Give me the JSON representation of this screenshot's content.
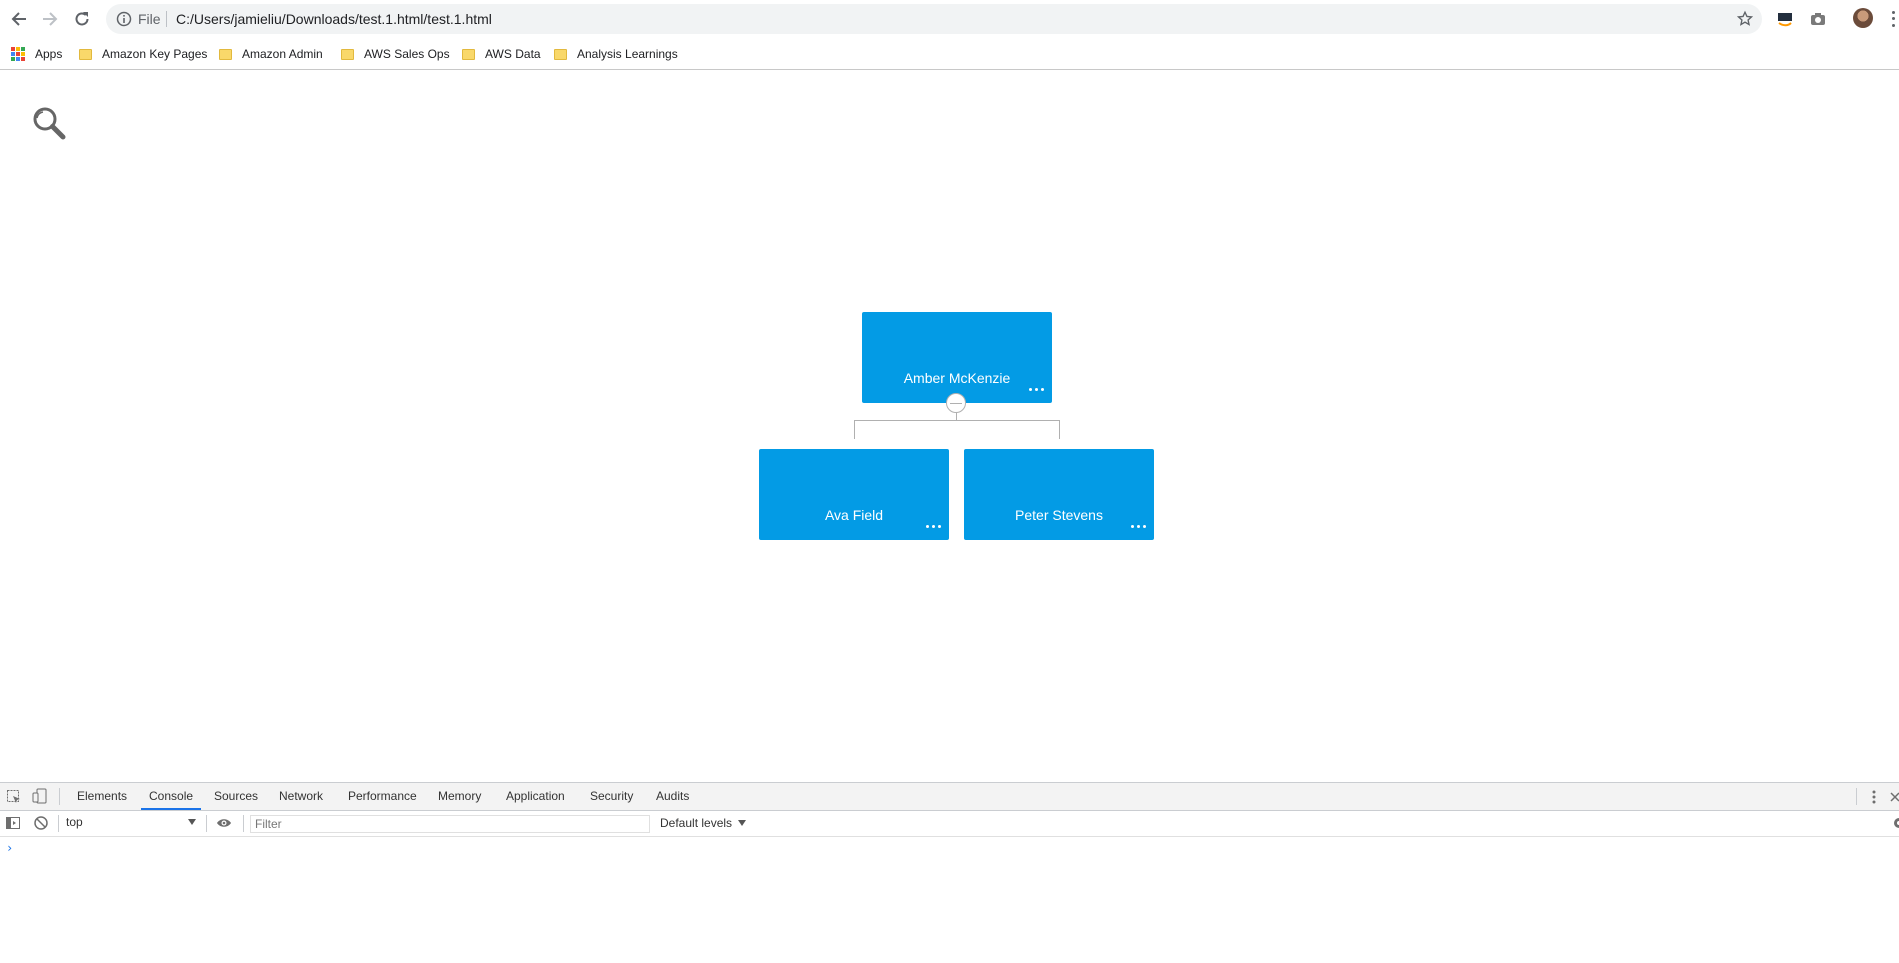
{
  "browser": {
    "address_scheme": "File",
    "url": "C:/Users/jamieliu/Downloads/test.1.html/test.1.html"
  },
  "bookmarks": [
    {
      "label": "Apps",
      "icon": "apps-grid-icon"
    },
    {
      "label": "Amazon Key Pages",
      "icon": "folder-icon"
    },
    {
      "label": "Amazon Admin",
      "icon": "folder-icon"
    },
    {
      "label": "AWS Sales Ops",
      "icon": "folder-icon"
    },
    {
      "label": "AWS Data",
      "icon": "folder-icon"
    },
    {
      "label": "Analysis Learnings",
      "icon": "folder-icon"
    }
  ],
  "org_chart": {
    "node_color": "#039be5",
    "root": {
      "name": "Amber McKenzie"
    },
    "children": [
      {
        "name": "Ava Field"
      },
      {
        "name": "Peter Stevens"
      }
    ]
  },
  "devtools": {
    "tabs": [
      "Elements",
      "Console",
      "Sources",
      "Network",
      "Performance",
      "Memory",
      "Application",
      "Security",
      "Audits"
    ],
    "active_tab": "Console",
    "context": "top",
    "filter_placeholder": "Filter",
    "levels": "Default levels",
    "prompt": "›"
  }
}
